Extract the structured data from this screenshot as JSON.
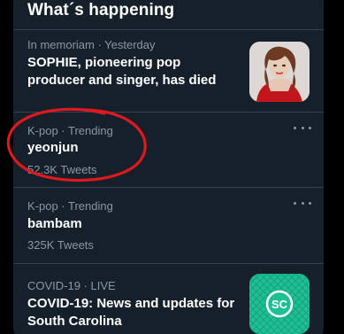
{
  "header": {
    "title": "What´s happening"
  },
  "trends": [
    {
      "meta": "In memoriam · Yesterday",
      "title": "SOPHIE, pioneering pop producer and singer, has died",
      "image": "portrait-photo"
    },
    {
      "meta": "K-pop · Trending",
      "title": "yeonjun",
      "count": "52.3K Tweets",
      "more": "more-options-icon"
    },
    {
      "meta": "K-pop · Trending",
      "title": "bambam",
      "count": "325K Tweets",
      "more": "more-options-icon"
    },
    {
      "meta": "COVID-19 · LIVE",
      "title": "COVID-19: News and updates for South Carolina",
      "image": "sc-badge",
      "badge_text": "SC"
    }
  ],
  "colors": {
    "panel_bg": "#15202b",
    "divider": "#38444d",
    "muted_text": "#8899a6",
    "annotation": "#e0191f",
    "badge": "#19b58e"
  }
}
